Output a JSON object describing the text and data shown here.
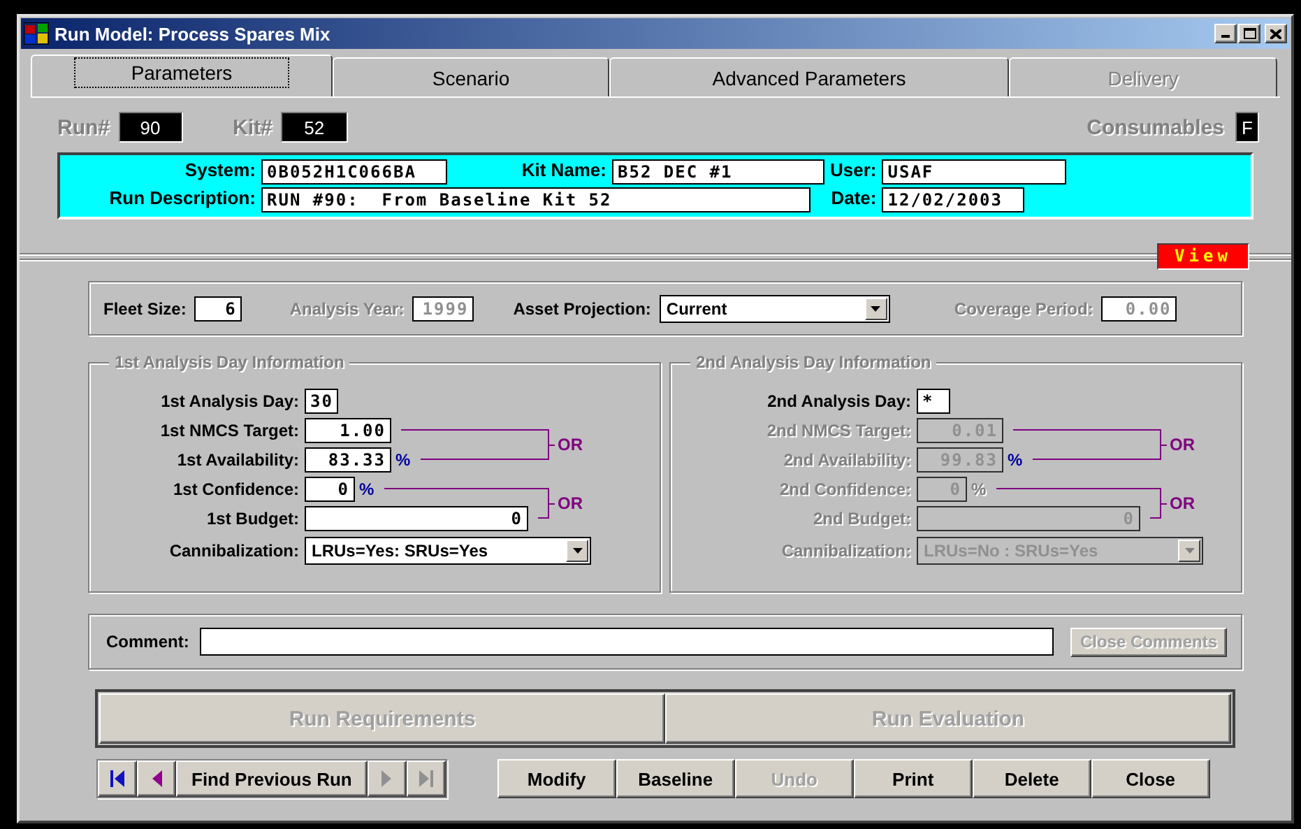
{
  "window": {
    "title": "Run Model: Process Spares Mix"
  },
  "tabs": [
    {
      "label": "Parameters",
      "selected": true,
      "disabled": false
    },
    {
      "label": "Scenario",
      "selected": false,
      "disabled": false
    },
    {
      "label": "Advanced Parameters",
      "selected": false,
      "disabled": false
    },
    {
      "label": "Delivery",
      "selected": false,
      "disabled": true
    }
  ],
  "run_info": {
    "run_label": "Run#",
    "run_value": "90",
    "kit_label": "Kit#",
    "kit_value": "52",
    "consumables_label": "Consumables",
    "consumables_value": "F"
  },
  "header": {
    "system_label": "System:",
    "system": "0B052H1C066BA",
    "kit_name_label": "Kit Name:",
    "kit_name": "B52 DEC #1",
    "user_label": "User:",
    "user": "USAF",
    "description_label": "Run Description:",
    "description": "RUN #90:  From Baseline Kit 52",
    "date_label": "Date:",
    "date": "12/02/2003"
  },
  "view_button": "View",
  "settings": [
    {
      "kind": "text",
      "label": "Fleet Size:",
      "value": "6",
      "disabled": false
    },
    {
      "kind": "text",
      "label": "Analysis Year:",
      "value": "1999",
      "disabled": true
    },
    {
      "kind": "dropdown",
      "label": "Asset Projection:",
      "value": "Current",
      "disabled": false
    },
    {
      "kind": "text",
      "label": "Coverage Period:",
      "value": "0.00",
      "disabled": true
    }
  ],
  "analysis_groups": [
    {
      "title": "1st Analysis Day Information",
      "or_labels": [
        "OR",
        "OR"
      ],
      "rows": [
        {
          "kind": "text",
          "label": "1st Analysis Day:",
          "value": "30",
          "disabled": false
        },
        {
          "kind": "text",
          "label": "1st NMCS Target:",
          "value": "1.00",
          "disabled": false
        },
        {
          "kind": "percent",
          "label": "1st Availability:",
          "value": "83.33",
          "unit": "%",
          "disabled": false
        },
        {
          "kind": "percent",
          "label": "1st Confidence:",
          "value": "0",
          "unit": "%",
          "disabled": false
        },
        {
          "kind": "text",
          "label": "1st Budget:",
          "value": "0",
          "disabled": false
        },
        {
          "kind": "dropdown",
          "label": "Cannibalization:",
          "value": "LRUs=Yes: SRUs=Yes",
          "disabled": false
        }
      ]
    },
    {
      "title": "2nd Analysis Day Information",
      "or_labels": [
        "OR",
        "OR"
      ],
      "rows": [
        {
          "kind": "text",
          "label": "2nd Analysis Day:",
          "value": "*",
          "disabled": false
        },
        {
          "kind": "text",
          "label": "2nd NMCS Target:",
          "value": "0.01",
          "disabled": true
        },
        {
          "kind": "percent",
          "label": "2nd Availability:",
          "value": "99.83",
          "unit": "%",
          "disabled": true
        },
        {
          "kind": "percent",
          "label": "2nd Confidence:",
          "value": "0",
          "unit": "%",
          "disabled": true
        },
        {
          "kind": "text",
          "label": "2nd Budget:",
          "value": "0",
          "disabled": true
        },
        {
          "kind": "dropdown",
          "label": "Cannibalization:",
          "value": "LRUs=No : SRUs=Yes",
          "disabled": true
        }
      ]
    }
  ],
  "comment": {
    "label": "Comment:",
    "close_button": "Close Comments",
    "close_disabled": true
  },
  "run_buttons": [
    {
      "label": "Run Requirements",
      "disabled": true
    },
    {
      "label": "Run Evaluation",
      "disabled": true
    }
  ],
  "navigation": [
    {
      "kind": "first",
      "disabled": false
    },
    {
      "kind": "previous",
      "disabled": false
    },
    {
      "kind": "find",
      "label": "Find Previous Run",
      "disabled": false
    },
    {
      "kind": "next",
      "disabled": true
    },
    {
      "kind": "last",
      "disabled": true
    }
  ],
  "actions": [
    {
      "label": "Modify",
      "disabled": false
    },
    {
      "label": "Baseline",
      "disabled": false
    },
    {
      "label": "Undo",
      "disabled": true
    },
    {
      "label": "Print",
      "disabled": false
    },
    {
      "label": "Delete",
      "disabled": false
    },
    {
      "label": "Close",
      "disabled": false
    }
  ]
}
